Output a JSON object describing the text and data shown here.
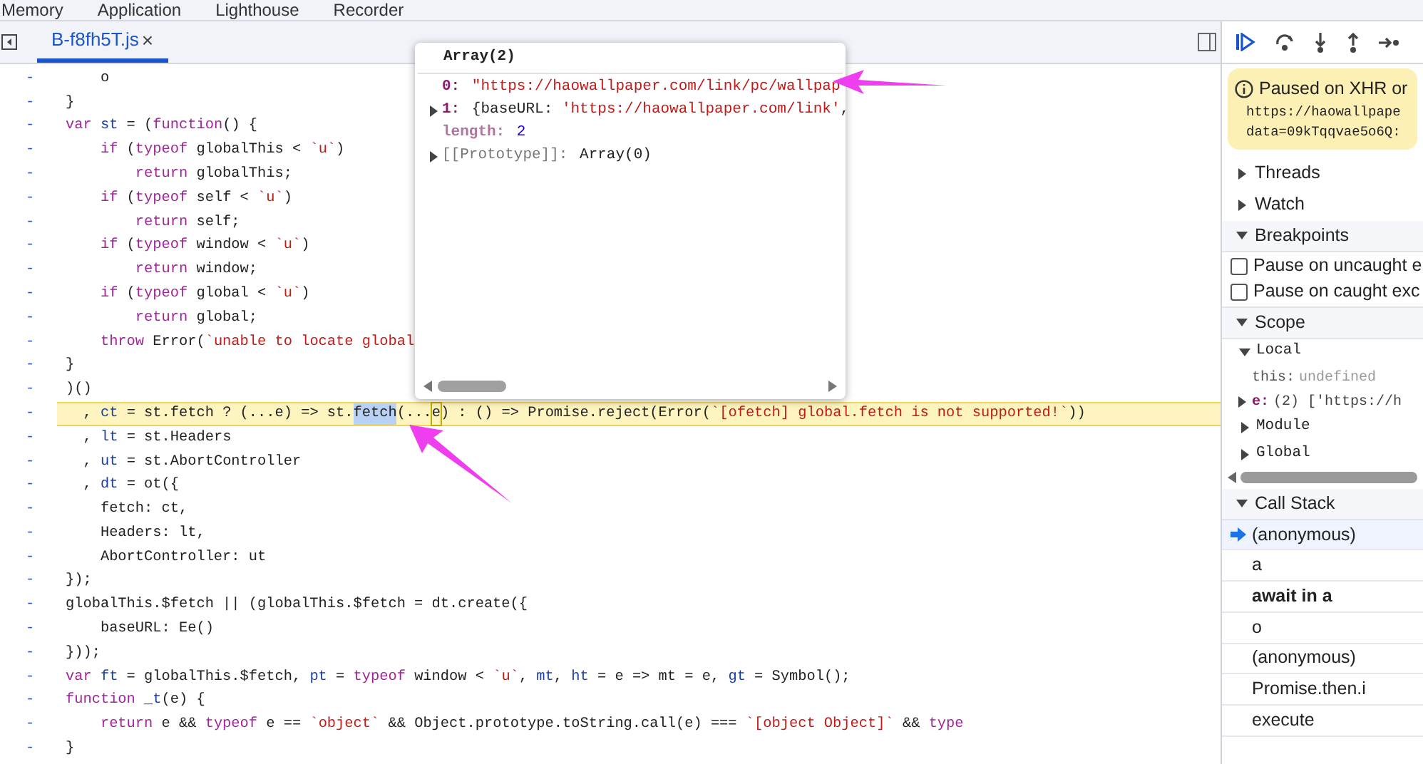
{
  "top_tabs": [
    {
      "label": "Memory",
      "selected": false
    },
    {
      "label": "Application",
      "selected": false
    },
    {
      "label": "Lighthouse",
      "selected": false
    },
    {
      "label": "Recorder",
      "selected": false
    }
  ],
  "file_tabs": [
    {
      "label": "B-f8fh5T.js",
      "close": "×",
      "selected": true
    }
  ],
  "code_lines": [
    {
      "marker": "-",
      "paused": false,
      "tokens": [
        {
          "kind": "txt",
          "text": "    o"
        }
      ]
    },
    {
      "marker": "-",
      "paused": false,
      "tokens": [
        {
          "kind": "txt",
          "text": "}"
        }
      ]
    },
    {
      "marker": "-",
      "paused": false,
      "tokens": [
        {
          "kind": "kw",
          "text": "var"
        },
        {
          "kind": "def",
          "text": " st"
        },
        {
          "kind": "txt",
          "text": " = ("
        },
        {
          "kind": "kw",
          "text": "function"
        },
        {
          "kind": "txt",
          "text": "() {"
        }
      ]
    },
    {
      "marker": "-",
      "paused": false,
      "tokens": [
        {
          "kind": "kw",
          "text": "    if"
        },
        {
          "kind": "txt",
          "text": " ("
        },
        {
          "kind": "kw",
          "text": "typeof"
        },
        {
          "kind": "txt",
          "text": " globalThis < "
        },
        {
          "kind": "str",
          "text": "`u`"
        },
        {
          "kind": "txt",
          "text": ")"
        }
      ]
    },
    {
      "marker": "-",
      "paused": false,
      "tokens": [
        {
          "kind": "kw",
          "text": "        return"
        },
        {
          "kind": "txt",
          "text": " globalThis;"
        }
      ]
    },
    {
      "marker": "-",
      "paused": false,
      "tokens": [
        {
          "kind": "kw",
          "text": "    if"
        },
        {
          "kind": "txt",
          "text": " ("
        },
        {
          "kind": "kw",
          "text": "typeof"
        },
        {
          "kind": "txt",
          "text": " self < "
        },
        {
          "kind": "str",
          "text": "`u`"
        },
        {
          "kind": "txt",
          "text": ")"
        }
      ]
    },
    {
      "marker": "-",
      "paused": false,
      "tokens": [
        {
          "kind": "kw",
          "text": "        return"
        },
        {
          "kind": "txt",
          "text": " self;"
        }
      ]
    },
    {
      "marker": "-",
      "paused": false,
      "tokens": [
        {
          "kind": "kw",
          "text": "    if"
        },
        {
          "kind": "txt",
          "text": " ("
        },
        {
          "kind": "kw",
          "text": "typeof"
        },
        {
          "kind": "txt",
          "text": " window < "
        },
        {
          "kind": "str",
          "text": "`u`"
        },
        {
          "kind": "txt",
          "text": ")"
        }
      ]
    },
    {
      "marker": "-",
      "paused": false,
      "tokens": [
        {
          "kind": "kw",
          "text": "        return"
        },
        {
          "kind": "txt",
          "text": " window;"
        }
      ]
    },
    {
      "marker": "-",
      "paused": false,
      "tokens": [
        {
          "kind": "kw",
          "text": "    if"
        },
        {
          "kind": "txt",
          "text": " ("
        },
        {
          "kind": "kw",
          "text": "typeof"
        },
        {
          "kind": "txt",
          "text": " global < "
        },
        {
          "kind": "str",
          "text": "`u`"
        },
        {
          "kind": "txt",
          "text": ")"
        }
      ]
    },
    {
      "marker": "-",
      "paused": false,
      "tokens": [
        {
          "kind": "kw",
          "text": "        return"
        },
        {
          "kind": "txt",
          "text": " global;"
        }
      ]
    },
    {
      "marker": "-",
      "paused": false,
      "tokens": [
        {
          "kind": "kw",
          "text": "    throw"
        },
        {
          "kind": "txt",
          "text": " Error("
        },
        {
          "kind": "str",
          "text": "`unable to locate global"
        }
      ]
    },
    {
      "marker": "-",
      "paused": false,
      "tokens": [
        {
          "kind": "txt",
          "text": "}"
        }
      ]
    },
    {
      "marker": "-",
      "paused": false,
      "tokens": [
        {
          "kind": "txt",
          "text": ")()"
        }
      ]
    },
    {
      "marker": "-",
      "paused": true,
      "tokens": [
        {
          "kind": "txt",
          "text": "  , "
        },
        {
          "kind": "def",
          "text": "ct"
        },
        {
          "kind": "txt",
          "text": " = st.fetch ? (...e) => st."
        },
        {
          "kind": "sel",
          "text": "fetch"
        },
        {
          "kind": "txt",
          "text": "(..."
        },
        {
          "kind": "match",
          "text": "e"
        },
        {
          "kind": "txt",
          "text": ") : () => Promise.reject(Error("
        },
        {
          "kind": "str",
          "text": "`[ofetch] global.fetch is not supported!`"
        },
        {
          "kind": "txt",
          "text": "))"
        }
      ]
    },
    {
      "marker": "-",
      "paused": false,
      "tokens": [
        {
          "kind": "txt",
          "text": "  , "
        },
        {
          "kind": "def",
          "text": "lt"
        },
        {
          "kind": "txt",
          "text": " = st.Headers"
        }
      ]
    },
    {
      "marker": "-",
      "paused": false,
      "tokens": [
        {
          "kind": "txt",
          "text": "  , "
        },
        {
          "kind": "def",
          "text": "ut"
        },
        {
          "kind": "txt",
          "text": " = st.AbortController"
        }
      ]
    },
    {
      "marker": "-",
      "paused": false,
      "tokens": [
        {
          "kind": "txt",
          "text": "  , "
        },
        {
          "kind": "def",
          "text": "dt"
        },
        {
          "kind": "txt",
          "text": " = ot({"
        }
      ]
    },
    {
      "marker": "-",
      "paused": false,
      "tokens": [
        {
          "kind": "txt",
          "text": "    fetch: ct,"
        }
      ]
    },
    {
      "marker": "-",
      "paused": false,
      "tokens": [
        {
          "kind": "txt",
          "text": "    Headers: lt,"
        }
      ]
    },
    {
      "marker": "-",
      "paused": false,
      "tokens": [
        {
          "kind": "txt",
          "text": "    AbortController: ut"
        }
      ]
    },
    {
      "marker": "-",
      "paused": false,
      "tokens": [
        {
          "kind": "txt",
          "text": "});"
        }
      ]
    },
    {
      "marker": "-",
      "paused": false,
      "tokens": [
        {
          "kind": "txt",
          "text": "globalThis.$fetch || (globalThis.$fetch = dt.create({"
        }
      ]
    },
    {
      "marker": "-",
      "paused": false,
      "tokens": [
        {
          "kind": "txt",
          "text": "    baseURL: Ee()"
        }
      ]
    },
    {
      "marker": "-",
      "paused": false,
      "tokens": [
        {
          "kind": "txt",
          "text": "}));"
        }
      ]
    },
    {
      "marker": "-",
      "paused": false,
      "tokens": [
        {
          "kind": "kw",
          "text": "var"
        },
        {
          "kind": "def",
          "text": " ft"
        },
        {
          "kind": "txt",
          "text": " = globalThis.$fetch, "
        },
        {
          "kind": "def",
          "text": "pt"
        },
        {
          "kind": "txt",
          "text": " = "
        },
        {
          "kind": "kw",
          "text": "typeof"
        },
        {
          "kind": "txt",
          "text": " window < "
        },
        {
          "kind": "str",
          "text": "`u`"
        },
        {
          "kind": "txt",
          "text": ", "
        },
        {
          "kind": "def",
          "text": "mt"
        },
        {
          "kind": "txt",
          "text": ", "
        },
        {
          "kind": "def",
          "text": "ht"
        },
        {
          "kind": "txt",
          "text": " = e => mt = e, "
        },
        {
          "kind": "def",
          "text": "gt"
        },
        {
          "kind": "txt",
          "text": " = Symbol();"
        }
      ]
    },
    {
      "marker": "-",
      "paused": false,
      "tokens": [
        {
          "kind": "kw",
          "text": "function"
        },
        {
          "kind": "def",
          "text": " _t"
        },
        {
          "kind": "txt",
          "text": "(e) {"
        }
      ]
    },
    {
      "marker": "-",
      "paused": false,
      "tokens": [
        {
          "kind": "kw",
          "text": "    return"
        },
        {
          "kind": "txt",
          "text": " e && "
        },
        {
          "kind": "kw",
          "text": "typeof"
        },
        {
          "kind": "txt",
          "text": " e == "
        },
        {
          "kind": "str",
          "text": "`object`"
        },
        {
          "kind": "txt",
          "text": " && Object.prototype.toString.call(e) === "
        },
        {
          "kind": "str",
          "text": "`[object Object]`"
        },
        {
          "kind": "txt",
          "text": " && "
        },
        {
          "kind": "kw",
          "text": "type"
        }
      ]
    },
    {
      "marker": "-",
      "paused": false,
      "tokens": [
        {
          "kind": "txt",
          "text": "}"
        }
      ]
    }
  ],
  "popover": {
    "title": "Array(2)",
    "items": [
      {
        "kind": "index",
        "key": "0:",
        "value": [
          {
            "kind": "str",
            "text": "\"https://haowallpaper.com/link/pc/wallpap"
          }
        ]
      },
      {
        "kind": "index",
        "key": "1:",
        "expanded": false,
        "value": [
          {
            "kind": "txt",
            "text": "{baseURL: "
          },
          {
            "kind": "str",
            "text": "'https://haowallpaper.com/link'"
          },
          {
            "kind": "txt",
            "text": ","
          }
        ]
      },
      {
        "kind": "property",
        "key": "length:",
        "value": [
          {
            "kind": "num",
            "text": "2"
          }
        ]
      },
      {
        "kind": "internal",
        "key": "[[Prototype]]:",
        "expanded": false,
        "value": [
          {
            "kind": "txt",
            "text": "Array(0)"
          }
        ]
      }
    ]
  },
  "paused_banner": {
    "title": "Paused on XHR or",
    "lines": [
      "https://haowallpape",
      "data=09kTqqvae5o6Q:"
    ]
  },
  "sections": [
    {
      "title": "Threads",
      "expanded": false
    },
    {
      "title": "Watch",
      "expanded": false
    },
    {
      "kind": "breakpoints",
      "title": "Breakpoints",
      "expanded": true,
      "options": [
        {
          "label": "Pause on uncaught e",
          "checked": false
        },
        {
          "label": "Pause on caught exc",
          "checked": false
        }
      ]
    },
    {
      "kind": "scope",
      "title": "Scope",
      "expanded": true,
      "children": [
        {
          "label": "Local",
          "expanded": true,
          "children": [
            {
              "name": "this:",
              "value": "undefined"
            },
            {
              "name": "e:",
              "value": "(2) ['https://h",
              "expanded": false
            }
          ]
        },
        {
          "label": "Module",
          "expanded": false
        },
        {
          "label": "Global",
          "expanded": false
        }
      ]
    },
    {
      "kind": "callstack",
      "title": "Call Stack",
      "expanded": true,
      "frames": [
        {
          "kind": "frame",
          "name": "(anonymous)",
          "selected": true
        },
        {
          "kind": "frame",
          "name": "a",
          "selected": false
        },
        {
          "kind": "async",
          "name": "await in a",
          "selected": false
        },
        {
          "kind": "frame",
          "name": "o",
          "selected": false
        },
        {
          "kind": "frame",
          "name": "(anonymous)",
          "selected": false
        },
        {
          "kind": "frame",
          "name": "Promise.then.i",
          "selected": false
        },
        {
          "kind": "frame",
          "name": "execute",
          "selected": false
        }
      ]
    }
  ]
}
